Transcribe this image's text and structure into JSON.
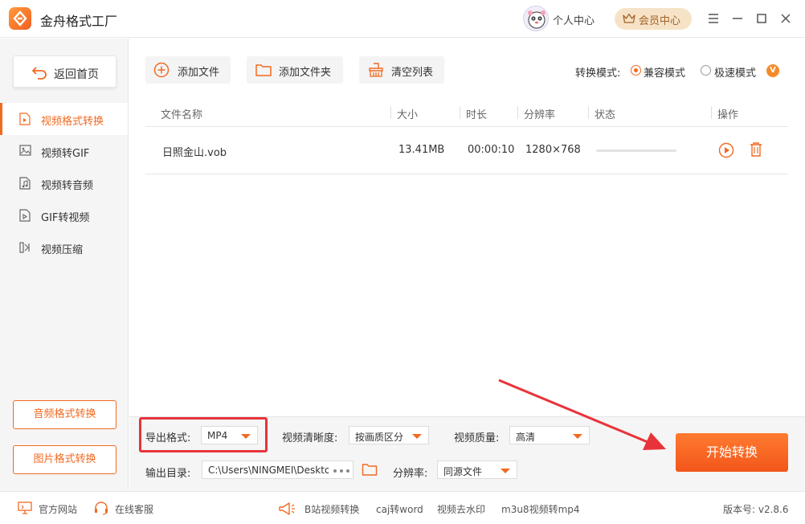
{
  "app": {
    "title": "金舟格式工厂"
  },
  "header": {
    "personal_center": "个人中心",
    "vip_center": "会员中心"
  },
  "sidebar": {
    "back_home": "返回首页",
    "items": [
      {
        "label": "视频格式转换",
        "icon": "video-file-icon",
        "active": true
      },
      {
        "label": "视频转GIF",
        "icon": "image-icon",
        "active": false
      },
      {
        "label": "视频转音频",
        "icon": "music-file-icon",
        "active": false
      },
      {
        "label": "GIF转视频",
        "icon": "play-file-icon",
        "active": false
      },
      {
        "label": "视频压缩",
        "icon": "compress-icon",
        "active": false
      }
    ],
    "bottom_buttons": [
      "音频格式转换",
      "图片格式转换"
    ]
  },
  "toolbar": {
    "add_file": "添加文件",
    "add_folder": "添加文件夹",
    "clear_list": "清空列表",
    "mode_label": "转换模式:",
    "modes": [
      {
        "label": "兼容模式",
        "checked": true
      },
      {
        "label": "极速模式",
        "checked": false
      }
    ],
    "mode_badge": "V"
  },
  "table": {
    "columns": [
      "文件名称",
      "大小",
      "时长",
      "分辨率",
      "状态",
      "操作"
    ],
    "rows": [
      {
        "name": "日照金山.vob",
        "size": "13.41MB",
        "duration": "00:00:10",
        "resolution": "1280×768",
        "progress": 0
      }
    ]
  },
  "settings": {
    "export_format_label": "导出格式:",
    "export_format_value": "MP4",
    "clarity_label": "视频清晰度:",
    "clarity_value": "按画质区分",
    "quality_label": "视频质量:",
    "quality_value": "高清",
    "output_dir_label": "输出目录:",
    "output_dir_value": "C:\\Users\\NINGMEI\\Desktop",
    "resolution_label": "分辨率:",
    "resolution_value": "同源文件",
    "start_button": "开始转换"
  },
  "footer": {
    "official_site": "官方网站",
    "online_service": "在线客服",
    "links": [
      "B站视频转换",
      "caj转word",
      "视频去水印",
      "m3u8视频转mp4"
    ],
    "version": "版本号: v2.8.6"
  },
  "colors": {
    "accent": "#f26a21",
    "highlight": "#e8333a"
  }
}
